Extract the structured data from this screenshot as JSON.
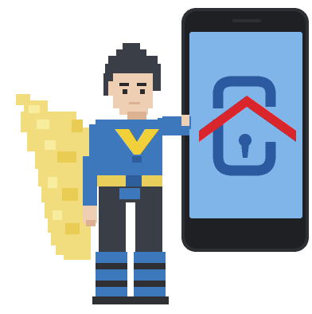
{
  "illustration": {
    "subject": "pixel-art-superhero-holding-smartphone",
    "icons": [
      "hero-icon",
      "smartphone-icon",
      "secure-home-icon"
    ]
  },
  "colors": {
    "background": "#ffffff",
    "cape": "#f1dc7e",
    "cape_shadow": "#e9cc54",
    "cape_highlight": "#f8ec9e",
    "hair": "#3a3e46",
    "skin": "#efcfb3",
    "skin_shadow": "#dcb293",
    "eye": "#2a2a2a",
    "suit": "#3e78bc",
    "suit_dark": "#2e5f9c",
    "emblem": "#f2d03a",
    "belt": "#e8ce5a",
    "pants": "#3a3e46",
    "boot_blue": "#3e78bc",
    "boot_dark": "#2e3034",
    "phone_body": "#2c2f33",
    "phone_bezel": "#1e2023",
    "phone_screen": "#7fb5e8",
    "lock_icon": "#2c5aa0",
    "roof_icon": "#d8262c"
  }
}
